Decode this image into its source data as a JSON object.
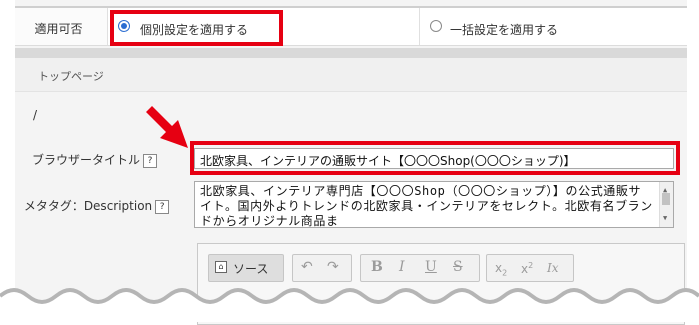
{
  "apply": {
    "label": "適用可否",
    "option_individual": "個別設定を適用する",
    "option_bulk": "一括設定を適用する",
    "selected": "individual"
  },
  "section": {
    "heading": "トップページ",
    "path": "/"
  },
  "fields": {
    "browser_title_label": "ブラウザータイトル",
    "browser_title_value": "北欧家具、インテリアの通販サイト【〇〇〇Shop(〇〇〇ショップ)】",
    "meta_description_label": "メタタグ：Description",
    "meta_description_value": "北欧家具、インテリア専門店【〇〇〇Shop（〇〇〇ショップ）】の公式通販サイト。国内外よりトレンドの北欧家具・インテリアをセレクト。北欧有名ブランドからオリジナル商品ま",
    "help_glyph": "?"
  },
  "editor": {
    "source_label": "ソース",
    "buttons": {
      "undo": "↶",
      "redo": "↷",
      "bold": "B",
      "italic": "I",
      "underline": "U",
      "strike": "S",
      "subscript": "x",
      "subscript_mark": "2",
      "superscript": "x",
      "superscript_mark": "2",
      "remove_format": "Ix"
    }
  },
  "colors": {
    "highlight": "#e60012",
    "radio_accent": "#2b6dd1"
  }
}
